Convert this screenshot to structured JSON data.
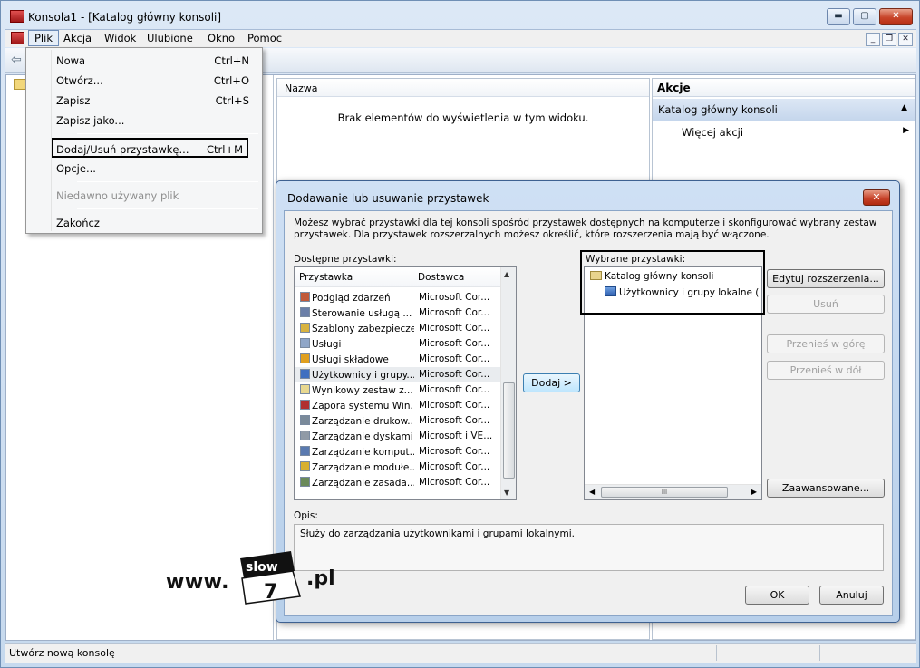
{
  "window": {
    "title": "Konsola1 - [Katalog główny konsoli]",
    "controls": {
      "minimize": "▬",
      "maximize": "▢",
      "close": "✕"
    }
  },
  "menubar": {
    "items": [
      "Plik",
      "Akcja",
      "Widok",
      "Ulubione",
      "Okno",
      "Pomoc"
    ],
    "mdi": {
      "minimize": "_",
      "restore": "❐",
      "close": "✕"
    }
  },
  "file_menu": {
    "items": [
      {
        "label": "Nowa",
        "shortcut": "Ctrl+N"
      },
      {
        "label": "Otwórz...",
        "shortcut": "Ctrl+O"
      },
      {
        "label": "Zapisz",
        "shortcut": "Ctrl+S"
      },
      {
        "label": "Zapisz jako...",
        "shortcut": ""
      },
      {
        "label": "Dodaj/Usuń przystawkę...",
        "shortcut": "Ctrl+M"
      },
      {
        "label": "Opcje...",
        "shortcut": ""
      },
      {
        "label": "Niedawno używany plik",
        "shortcut": ""
      },
      {
        "label": "Zakończ",
        "shortcut": ""
      }
    ]
  },
  "list_pane": {
    "column": "Nazwa",
    "empty_message": "Brak elementów do wyświetlenia w tym widoku."
  },
  "actions_pane": {
    "header": "Akcje",
    "group": "Katalog główny konsoli",
    "more": "Więcej akcji"
  },
  "statusbar": {
    "text": "Utwórz nową konsolę"
  },
  "dialog": {
    "title": "Dodawanie lub usuwanie przystawek",
    "close": "✕",
    "intro": "Możesz wybrać przystawki dla tej konsoli spośród przystawek dostępnych na komputerze i skonfigurować wybrany zestaw przystawek. Dla przystawek rozszerzalnych możesz określić, które rozszerzenia mają być włączone.",
    "available_label": "Dostępne przystawki:",
    "available_columns": [
      "Przystawka",
      "Dostawca"
    ],
    "available_rows": [
      {
        "name": "Podgląd zdarzeń",
        "vendor": "Microsoft Cor...",
        "color": "#c05a3a"
      },
      {
        "name": "Sterowanie usługą ...",
        "vendor": "Microsoft Cor...",
        "color": "#6b7fa8"
      },
      {
        "name": "Szablony zabezpieczeń",
        "vendor": "Microsoft Cor...",
        "color": "#d8b340"
      },
      {
        "name": "Usługi",
        "vendor": "Microsoft Cor...",
        "color": "#8fa6c8"
      },
      {
        "name": "Usługi składowe",
        "vendor": "Microsoft Cor...",
        "color": "#e0a020"
      },
      {
        "name": "Użytkownicy i grupy...",
        "vendor": "Microsoft Cor...",
        "color": "#3f6fc0"
      },
      {
        "name": "Wynikowy zestaw z...",
        "vendor": "Microsoft Cor...",
        "color": "#e8d890"
      },
      {
        "name": "Zapora systemu Win...",
        "vendor": "Microsoft Cor...",
        "color": "#b03030"
      },
      {
        "name": "Zarządzanie drukow...",
        "vendor": "Microsoft Cor...",
        "color": "#7a8a9a"
      },
      {
        "name": "Zarządzanie dyskami",
        "vendor": "Microsoft i VE...",
        "color": "#909aa6"
      },
      {
        "name": "Zarządzanie komput...",
        "vendor": "Microsoft Cor...",
        "color": "#5a7ab0"
      },
      {
        "name": "Zarządzanie modułe...",
        "vendor": "Microsoft Cor...",
        "color": "#d8b030"
      },
      {
        "name": "Zarządzanie zasada...",
        "vendor": "Microsoft Cor...",
        "color": "#6a8a5a"
      }
    ],
    "add_button": "Dodaj >",
    "selected_label": "Wybrane przystawki:",
    "selected_root": "Katalog główny konsoli",
    "selected_child": "Użytkownicy i grupy lokalne (lok",
    "hscroll_grip": "III",
    "buttons": {
      "edit_extensions": "Edytuj rozszerzenia...",
      "remove": "Usuń",
      "move_up": "Przenieś w górę",
      "move_down": "Przenieś w dół",
      "advanced": "Zaawansowane...",
      "ok": "OK",
      "cancel": "Anuluj"
    },
    "description_label": "Opis:",
    "description": "Służy do zarządzania użytkownikami i grupami lokalnymi."
  },
  "watermark": {
    "prefix": "www.",
    "word": "slow",
    "digit": "7",
    "suffix": ".pl"
  }
}
